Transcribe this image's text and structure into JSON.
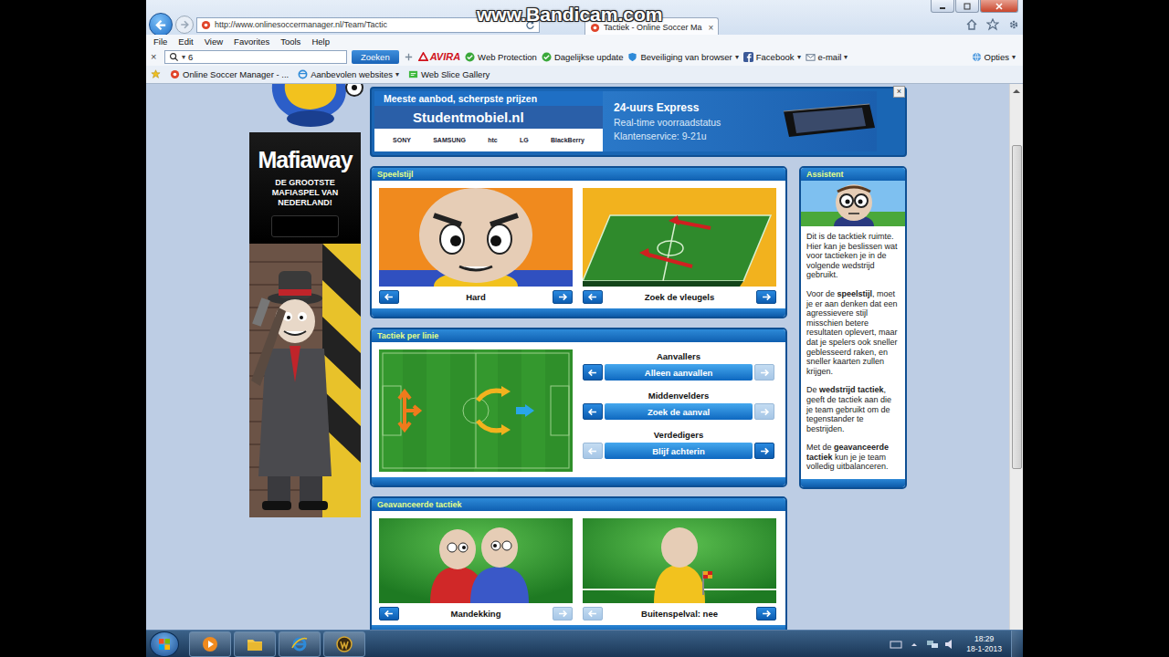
{
  "watermark": "www.Bandicam.com",
  "browser": {
    "address": "http://www.onlinesoccermanager.nl/Team/Tactic",
    "tab": {
      "label": "Tactiek - Online Soccer Ma",
      "close": "×",
      "selected": true
    },
    "menu": [
      "File",
      "Edit",
      "View",
      "Favorites",
      "Tools",
      "Help"
    ],
    "toolbar": {
      "close": "×",
      "search_value": "6",
      "search_button": "Zoeken",
      "avira": "AVIRA",
      "web_protection": "Web Protection",
      "daily_update": "Dagelijkse update",
      "browser_security": "Beveiliging van browser",
      "facebook": "Facebook",
      "email": "e-mail",
      "options": "Opties",
      "menu_arrow": "▾"
    },
    "favorites": {
      "online_soccer_manager": "Online Soccer Manager - ...",
      "recommended": "Aanbevolen websites",
      "web_slice": "Web Slice Gallery",
      "menu_arrow": "▾"
    }
  },
  "page": {
    "mafia_ad": {
      "title": "Mafiaway",
      "tagline": "DE GROOTSTE MAFIASPEL VAN NEDERLAND!"
    },
    "banner": {
      "headline": "Meeste aanbod, scherpste prijzen",
      "brand": "Studentmobiel.nl",
      "logos": [
        "SONY",
        "SAMSUNG",
        "htc",
        "LG",
        "BlackBerry"
      ],
      "features": [
        "24-uurs Express",
        "Real-time voorraadstatus",
        "Klantenservice: 9-21u"
      ],
      "close": "×"
    },
    "play_style": {
      "title": "Speelstijl",
      "options": [
        {
          "label": "Hard",
          "prev_enabled": true,
          "next_enabled": true
        },
        {
          "label": "Zoek de vleugels",
          "prev_enabled": true,
          "next_enabled": true
        }
      ]
    },
    "line_tactics": {
      "title": "Tactiek per linie",
      "lines": [
        {
          "group": "Aanvallers",
          "value": "Alleen aanvallen",
          "prev_enabled": true,
          "next_enabled": false
        },
        {
          "group": "Middenvelders",
          "value": "Zoek de aanval",
          "prev_enabled": true,
          "next_enabled": false
        },
        {
          "group": "Verdedigers",
          "value": "Blijf achterin",
          "prev_enabled": false,
          "next_enabled": true
        }
      ]
    },
    "advanced": {
      "title": "Geavanceerde tactiek",
      "options": [
        {
          "label": "Mandekking",
          "prev_enabled": true,
          "next_enabled": false
        },
        {
          "label": "Buitenspelval: nee",
          "prev_enabled": false,
          "next_enabled": true
        }
      ]
    },
    "assistant": {
      "title": "Assistent",
      "paragraphs": [
        [
          {
            "text": "Dit is de tacktiek ruimte. Hier kan je beslissen wat voor tactieken je in de volgende wedstrijd gebruikt.",
            "bold": false
          }
        ],
        [
          {
            "text": "Voor de ",
            "bold": false
          },
          {
            "text": "speelstijl",
            "bold": true
          },
          {
            "text": ", moet je er aan denken dat een agressievere stijl misschien betere resultaten oplevert, maar dat je spelers ook sneller geblesseerd raken, en sneller kaarten zullen krijgen.",
            "bold": false
          }
        ],
        [
          {
            "text": "De ",
            "bold": false
          },
          {
            "text": "wedstrijd tactiek",
            "bold": true
          },
          {
            "text": ", geeft de tactiek aan die je team gebruikt om de tegenstander te bestrijden.",
            "bold": false
          }
        ],
        [
          {
            "text": "Met de ",
            "bold": false
          },
          {
            "text": "geavanceerde tactiek",
            "bold": true
          },
          {
            "text": " kun je je team volledig uitbalanceren.",
            "bold": false
          }
        ]
      ]
    }
  },
  "taskbar": {
    "time": "18:29",
    "date": "18-1-2013"
  }
}
